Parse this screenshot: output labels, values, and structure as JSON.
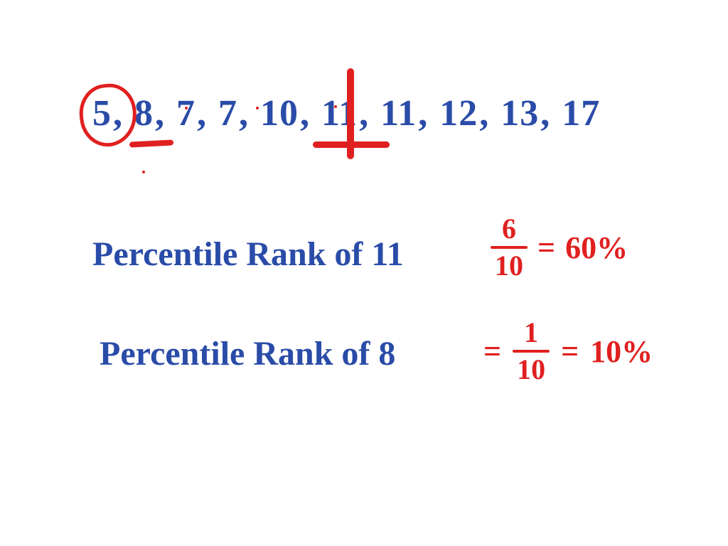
{
  "data_values": [
    "5",
    "8",
    "7",
    "7",
    "10",
    "11",
    "11",
    "12",
    "13",
    "17"
  ],
  "separator": ",",
  "circled_index": 0,
  "underlined_index": 1,
  "split_after_index": 5,
  "line2": {
    "label": "Percentile Rank of 11",
    "fraction_num": "6",
    "fraction_den": "10",
    "equals": "=",
    "result": "60%"
  },
  "line3": {
    "label": "Percentile Rank of 8",
    "equals1": "=",
    "fraction_num": "1",
    "fraction_den": "10",
    "equals2": "=",
    "result": "10%"
  },
  "colors": {
    "blue": "#2a4ca8",
    "red": "#e02020"
  }
}
